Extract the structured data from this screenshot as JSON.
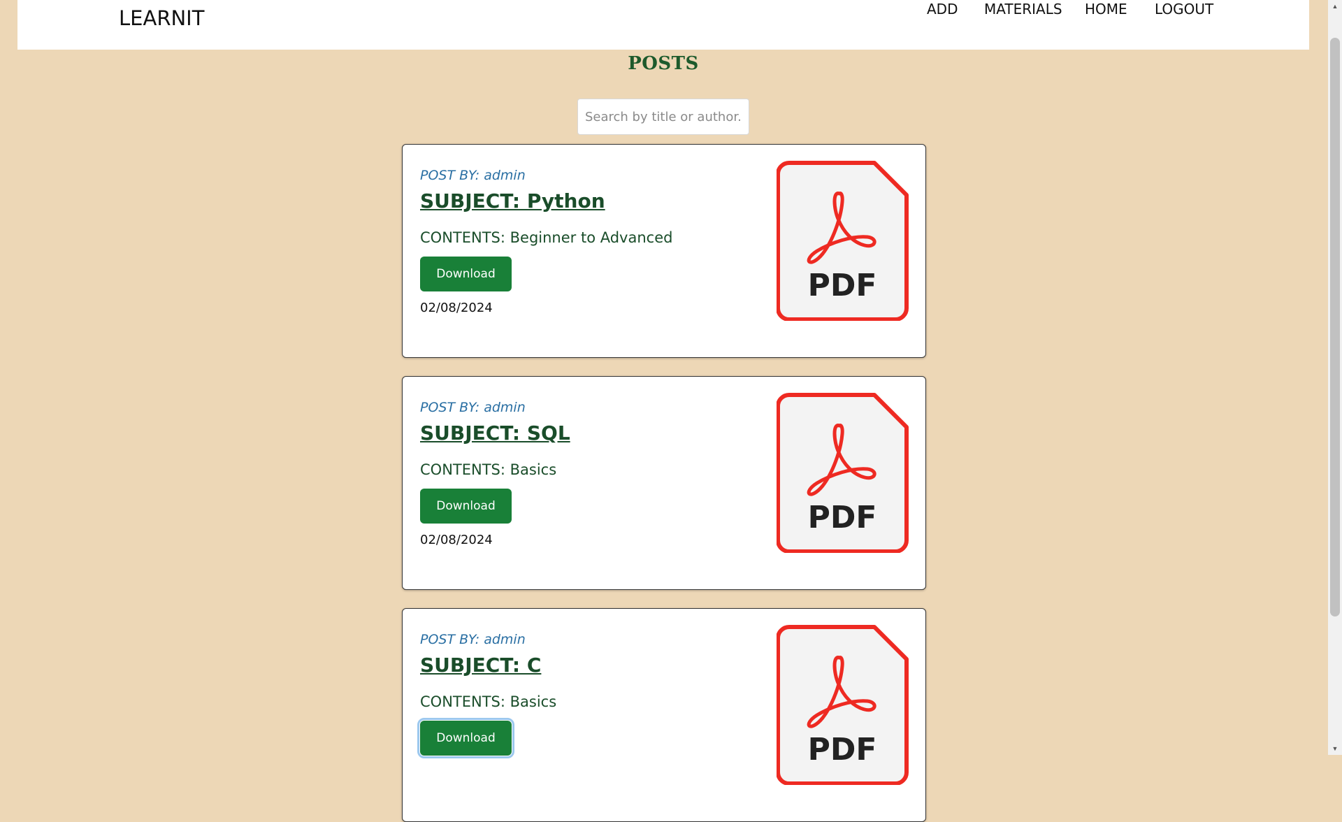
{
  "header": {
    "brand": "LEARNIT",
    "nav": [
      {
        "label": "ADD"
      },
      {
        "label": "MATERIALS"
      },
      {
        "label": "HOME"
      },
      {
        "label": "LOGOUT"
      }
    ]
  },
  "main": {
    "title": "POSTS",
    "search": {
      "placeholder": "Search by title or author...",
      "value": ""
    },
    "posts": [
      {
        "author": "POST BY: admin",
        "subject": "SUBJECT: Python",
        "contents": "CONTENTS: Beginner to Advanced",
        "download_label": "Download",
        "date": "02/08/2024",
        "icon_label": "PDF"
      },
      {
        "author": "POST BY: admin",
        "subject": "SUBJECT: SQL",
        "contents": "CONTENTS: Basics",
        "download_label": "Download",
        "date": "02/08/2024",
        "icon_label": "PDF"
      },
      {
        "author": "POST BY: admin",
        "subject": "SUBJECT: C",
        "contents": "CONTENTS: Basics",
        "download_label": "Download",
        "date": "",
        "icon_label": "PDF"
      }
    ]
  },
  "colors": {
    "page_background": "#edd7b6",
    "heading_green": "#1a4d2a",
    "author_blue": "#2a6fa3",
    "button_green": "#198038",
    "pdf_red": "#ee2a22"
  },
  "icons": {
    "pdf": "pdf-file-icon",
    "scroll_up": "scroll-up-arrow-icon",
    "scroll_down": "scroll-down-arrow-icon"
  }
}
